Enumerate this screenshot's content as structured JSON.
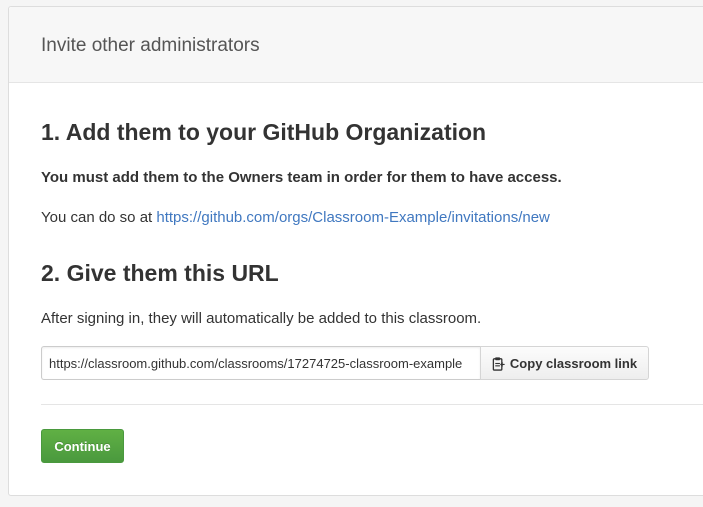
{
  "panel": {
    "title": "Invite other administrators"
  },
  "step1": {
    "heading": "1. Add them to your GitHub Organization",
    "must_add": "You must add them to the Owners team in order for them to have access.",
    "do_so_prefix": "You can do so at ",
    "invitation_link": "https://github.com/orgs/Classroom-Example/invitations/new"
  },
  "step2": {
    "heading": "2. Give them this URL",
    "after_signin": "After signing in, they will automatically be added to this classroom.",
    "classroom_url": "https://classroom.github.com/classrooms/17274725-classroom-example",
    "copy_label": "Copy classroom link",
    "copy_icon": "clippy-icon"
  },
  "actions": {
    "continue_label": "Continue",
    "continue_color": "#55a532"
  },
  "colors": {
    "link": "#4078c0",
    "text": "#333333",
    "header_bg": "#f7f7f7"
  }
}
